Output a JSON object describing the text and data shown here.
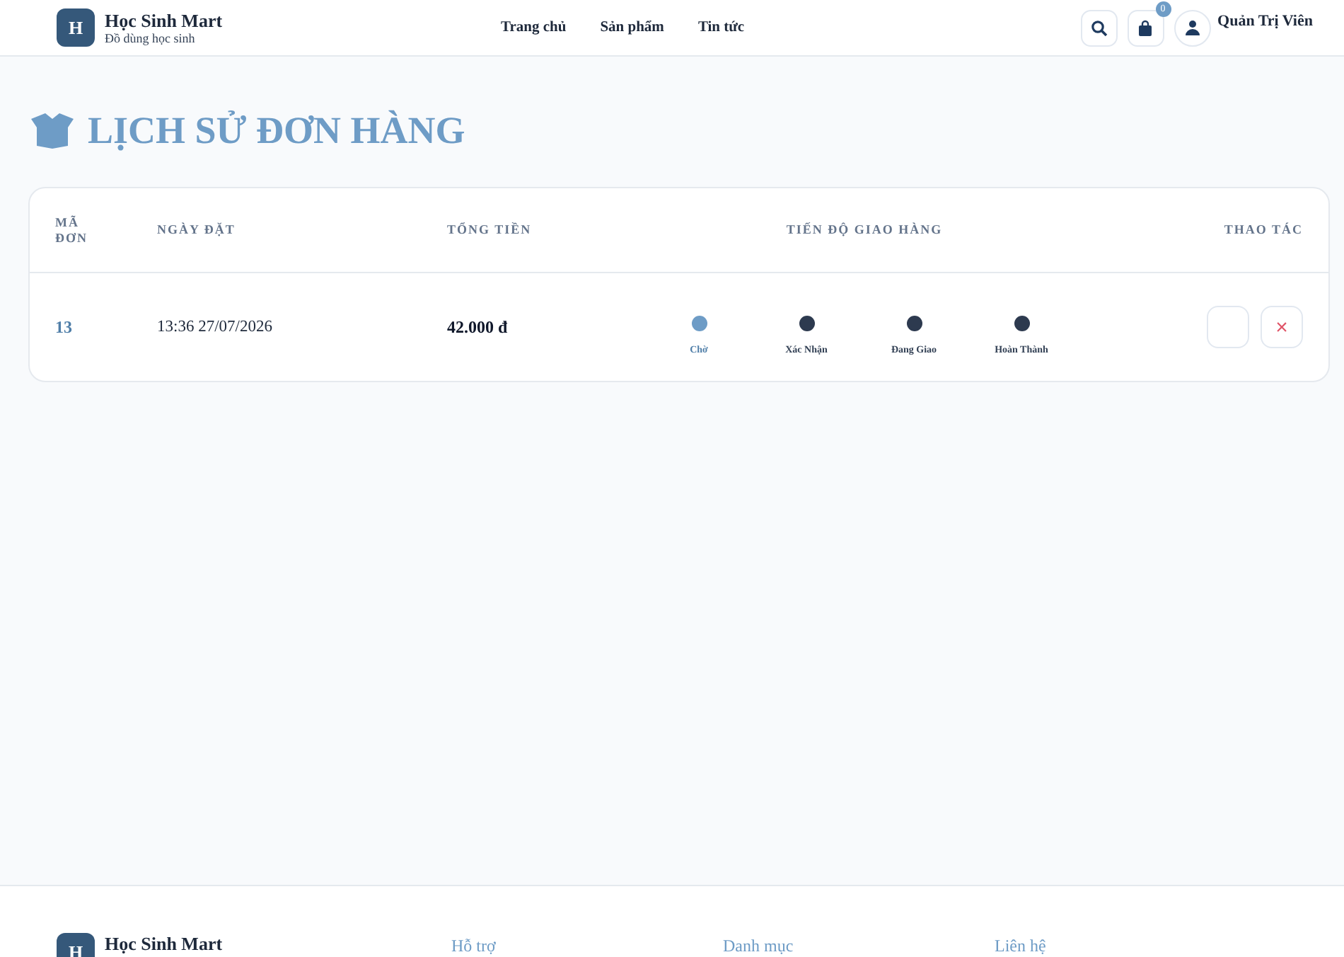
{
  "header": {
    "logo_letter": "H",
    "brand": "Học Sinh Mart",
    "tagline": "Đồ dùng học sinh",
    "nav": [
      {
        "label": "Trang chủ"
      },
      {
        "label": "Sản phẩm"
      },
      {
        "label": "Tin tức"
      }
    ],
    "cart_count": "0",
    "user_name": "Quản Trị Viên"
  },
  "page_title": "LỊCH SỬ ĐƠN HÀNG",
  "table": {
    "columns": [
      "MÃ ĐƠN",
      "NGÀY ĐẶT",
      "TỔNG TIỀN",
      "TIẾN ĐỘ GIAO HÀNG",
      "THAO TÁC"
    ],
    "rows": [
      {
        "id": "13",
        "date": "13:36 27/07/2026",
        "total": "42.000 đ",
        "steps": [
          {
            "label": "Chờ",
            "active": true
          },
          {
            "label": "Xác Nhận",
            "active": false
          },
          {
            "label": "Đang Giao",
            "active": false
          },
          {
            "label": "Hoàn Thành",
            "active": false
          }
        ],
        "cancel": "×"
      }
    ]
  },
  "footer": {
    "logo_letter": "H",
    "brand": "Học Sinh Mart",
    "links": [
      "Hỗ trợ",
      "Danh mục",
      "Liên hệ"
    ]
  }
}
